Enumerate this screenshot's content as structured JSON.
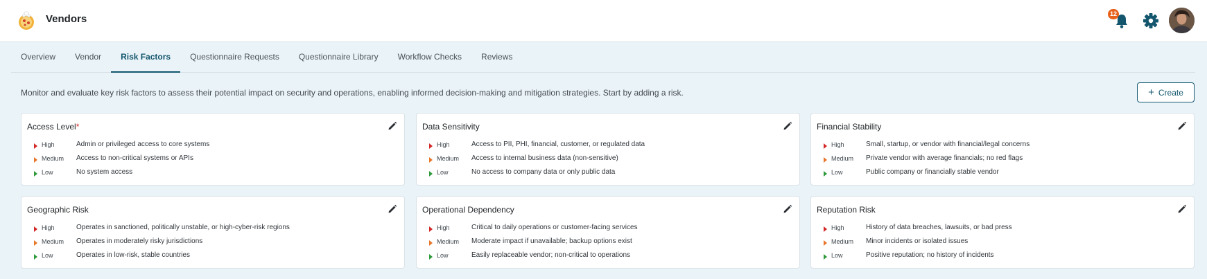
{
  "header": {
    "title": "Vendors",
    "notifications_count": "12",
    "logo_icon": "pizza-logo-icon",
    "bell_icon": "bell-icon",
    "settings_icon": "gear-icon",
    "accent_color": "#13566d"
  },
  "tabs": [
    {
      "label": "Overview",
      "active": false
    },
    {
      "label": "Vendor",
      "active": false
    },
    {
      "label": "Risk Factors",
      "active": true
    },
    {
      "label": "Questionnaire Requests",
      "active": false
    },
    {
      "label": "Questionnaire Library",
      "active": false
    },
    {
      "label": "Workflow Checks",
      "active": false
    },
    {
      "label": "Reviews",
      "active": false
    }
  ],
  "description": "Monitor and evaluate key risk factors to assess their potential impact on security and operations, enabling informed decision-making and mitigation strategies. Start by adding a risk.",
  "create_label": "Create",
  "level_colors": {
    "High": "#d42828",
    "Medium": "#e8762a",
    "Low": "#2e9a3a"
  },
  "cards": [
    {
      "title": "Access Level",
      "required": "*",
      "rows": [
        {
          "level": "High",
          "text": "Admin or privileged access to core systems"
        },
        {
          "level": "Medium",
          "text": "Access to non-critical systems or APIs"
        },
        {
          "level": "Low",
          "text": "No system access"
        }
      ]
    },
    {
      "title": "Data Sensitivity",
      "required": "",
      "rows": [
        {
          "level": "High",
          "text": "Access to PII, PHI, financial, customer, or regulated data"
        },
        {
          "level": "Medium",
          "text": "Access to internal business data (non-sensitive)"
        },
        {
          "level": "Low",
          "text": "No access to company data or only public data"
        }
      ]
    },
    {
      "title": "Financial Stability",
      "required": "",
      "rows": [
        {
          "level": "High",
          "text": "Small, startup, or vendor with financial/legal concerns"
        },
        {
          "level": "Medium",
          "text": "Private vendor with average financials; no red flags"
        },
        {
          "level": "Low",
          "text": "Public company or financially stable vendor"
        }
      ]
    },
    {
      "title": "Geographic Risk",
      "required": "",
      "rows": [
        {
          "level": "High",
          "text": "Operates in sanctioned, politically unstable, or high-cyber-risk regions"
        },
        {
          "level": "Medium",
          "text": "Operates in moderately risky jurisdictions"
        },
        {
          "level": "Low",
          "text": "Operates in low-risk, stable countries"
        }
      ]
    },
    {
      "title": "Operational Dependency",
      "required": "",
      "rows": [
        {
          "level": "High",
          "text": "Critical to daily operations or customer-facing services"
        },
        {
          "level": "Medium",
          "text": "Moderate impact if unavailable; backup options exist"
        },
        {
          "level": "Low",
          "text": "Easily replaceable vendor; non-critical to operations"
        }
      ]
    },
    {
      "title": "Reputation Risk",
      "required": "",
      "rows": [
        {
          "level": "High",
          "text": "History of data breaches, lawsuits, or bad press"
        },
        {
          "level": "Medium",
          "text": "Minor incidents or isolated issues"
        },
        {
          "level": "Low",
          "text": "Positive reputation; no history of incidents"
        }
      ]
    }
  ]
}
